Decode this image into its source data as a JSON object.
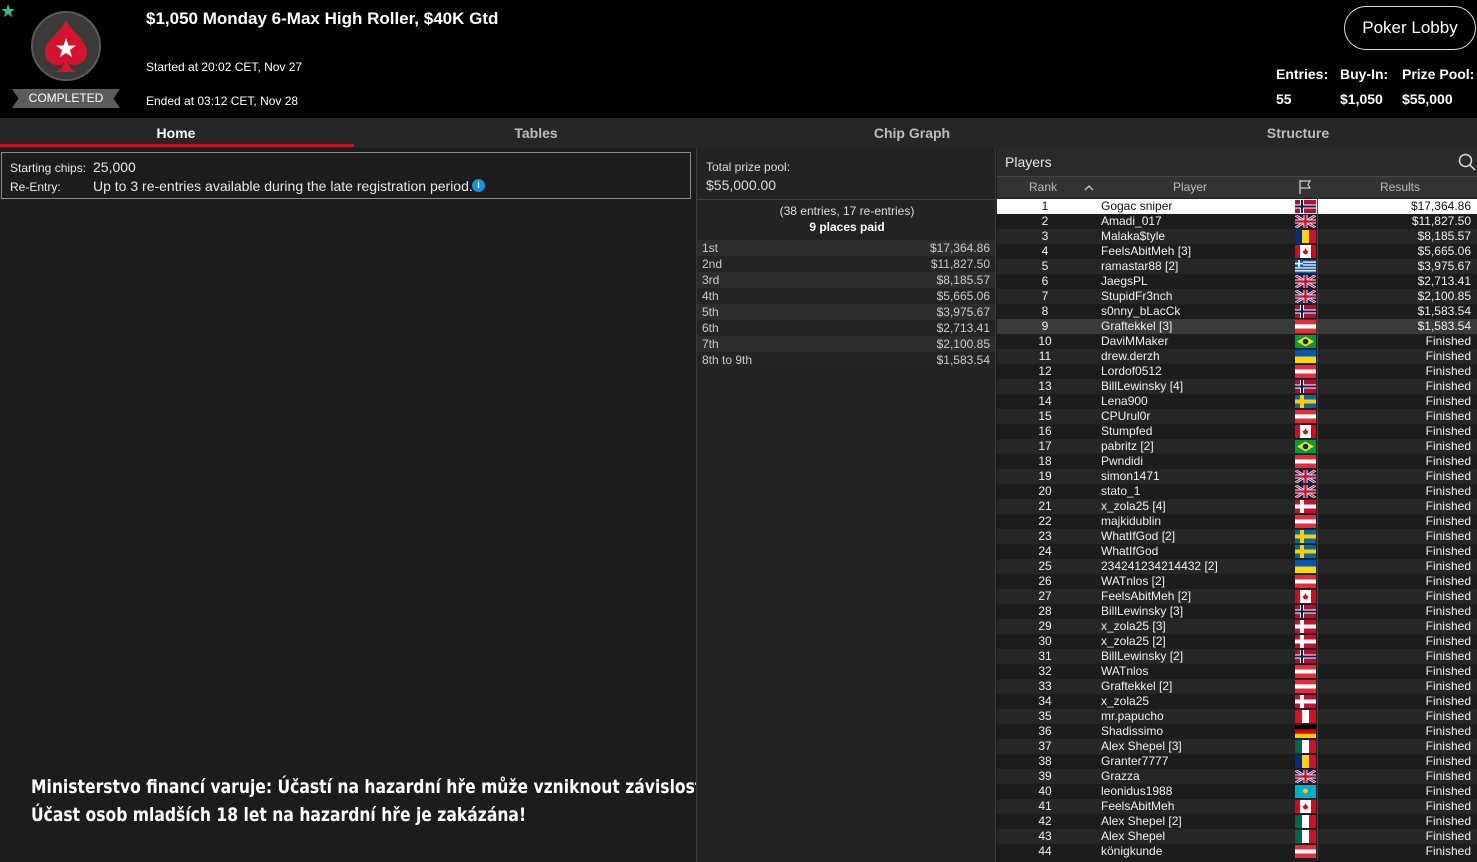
{
  "header": {
    "title": "$1,050 Monday 6-Max High Roller, $40K Gtd",
    "status_badge": "COMPLETED",
    "started": "Started at 20:02 CET, Nov 27",
    "ended": "Ended at 03:12 CET, Nov 28",
    "lobby_button": "Poker Lobby",
    "entries_label": "Entries:",
    "entries_value": "55",
    "buyin_label": "Buy-In:",
    "buyin_value": "$1,050",
    "prizepool_label": "Prize Pool:",
    "prizepool_value": "$55,000"
  },
  "tabs": [
    "Home",
    "Tables",
    "Chip Graph",
    "Structure"
  ],
  "info": {
    "starting_chips_label": "Starting chips:",
    "starting_chips_value": "25,000",
    "reentry_label": "Re-Entry:",
    "reentry_value": "Up to 3 re-entries available during the late registration period."
  },
  "warning": {
    "line1": "Ministerstvo financí varuje: Účastí na hazardní hře může vzniknout závislost!",
    "line2": "Účast osob mladších 18 let na hazardní hře je zakázána!"
  },
  "prize": {
    "pool_label": "Total prize pool:",
    "pool_value": "$55,000.00",
    "entries_text": "(38 entries, 17 re-entries)",
    "places_text": "9 places paid",
    "payouts": [
      {
        "place": "1st",
        "amount": "$17,364.86"
      },
      {
        "place": "2nd",
        "amount": "$11,827.50"
      },
      {
        "place": "3rd",
        "amount": "$8,185.57"
      },
      {
        "place": "4th",
        "amount": "$5,665.06"
      },
      {
        "place": "5th",
        "amount": "$3,975.67"
      },
      {
        "place": "6th",
        "amount": "$2,713.41"
      },
      {
        "place": "7th",
        "amount": "$2,100.85"
      },
      {
        "place": "8th to 9th",
        "amount": "$1,583.54"
      }
    ]
  },
  "players": {
    "title": "Players",
    "col_rank": "Rank",
    "col_player": "Player",
    "col_results": "Results",
    "rows": [
      {
        "rank": "1",
        "name": "Gogac sniper",
        "flag": "no",
        "result": "$17,364.86"
      },
      {
        "rank": "2",
        "name": "Amadi_017",
        "flag": "gb",
        "result": "$11,827.50"
      },
      {
        "rank": "3",
        "name": "Malaka$tyle",
        "flag": "ro",
        "result": "$8,185.57"
      },
      {
        "rank": "4",
        "name": "FeelsAbitMeh [3]",
        "flag": "ca",
        "result": "$5,665.06"
      },
      {
        "rank": "5",
        "name": "ramastar88 [2]",
        "flag": "gr",
        "result": "$3,975.67"
      },
      {
        "rank": "6",
        "name": "JaegsPL",
        "flag": "gb",
        "result": "$2,713.41"
      },
      {
        "rank": "7",
        "name": "StupidFr3nch",
        "flag": "gb",
        "result": "$2,100.85"
      },
      {
        "rank": "8",
        "name": "s0nny_bLacCk",
        "flag": "no",
        "result": "$1,583.54"
      },
      {
        "rank": "9",
        "name": "Graftekkel [3]",
        "flag": "at",
        "result": "$1,583.54"
      },
      {
        "rank": "10",
        "name": "DaviMMaker",
        "flag": "br",
        "result": "Finished"
      },
      {
        "rank": "11",
        "name": "drew.derzh",
        "flag": "ua",
        "result": "Finished"
      },
      {
        "rank": "12",
        "name": "Lordof0512",
        "flag": "at",
        "result": "Finished"
      },
      {
        "rank": "13",
        "name": "BillLewinsky [4]",
        "flag": "no",
        "result": "Finished"
      },
      {
        "rank": "14",
        "name": "Lena900",
        "flag": "se",
        "result": "Finished"
      },
      {
        "rank": "15",
        "name": "CPUrul0r",
        "flag": "at",
        "result": "Finished"
      },
      {
        "rank": "16",
        "name": "Stumpfed",
        "flag": "ca",
        "result": "Finished"
      },
      {
        "rank": "17",
        "name": "pabritz [2]",
        "flag": "br",
        "result": "Finished"
      },
      {
        "rank": "18",
        "name": "Pwndidi",
        "flag": "at",
        "result": "Finished"
      },
      {
        "rank": "19",
        "name": "simon1471",
        "flag": "gb",
        "result": "Finished"
      },
      {
        "rank": "20",
        "name": "stato_1",
        "flag": "gb",
        "result": "Finished"
      },
      {
        "rank": "21",
        "name": "x_zola25 [4]",
        "flag": "dk",
        "result": "Finished"
      },
      {
        "rank": "22",
        "name": "majkidublin",
        "flag": "at",
        "result": "Finished"
      },
      {
        "rank": "23",
        "name": "WhatIfGod [2]",
        "flag": "se",
        "result": "Finished"
      },
      {
        "rank": "24",
        "name": "WhatIfGod",
        "flag": "se",
        "result": "Finished"
      },
      {
        "rank": "25",
        "name": "234241234214432 [2]",
        "flag": "ua",
        "result": "Finished"
      },
      {
        "rank": "26",
        "name": "WATnlos [2]",
        "flag": "at",
        "result": "Finished"
      },
      {
        "rank": "27",
        "name": "FeelsAbitMeh [2]",
        "flag": "ca",
        "result": "Finished"
      },
      {
        "rank": "28",
        "name": "BillLewinsky [3]",
        "flag": "no",
        "result": "Finished"
      },
      {
        "rank": "29",
        "name": "x_zola25 [3]",
        "flag": "dk",
        "result": "Finished"
      },
      {
        "rank": "30",
        "name": "x_zola25 [2]",
        "flag": "dk",
        "result": "Finished"
      },
      {
        "rank": "31",
        "name": "BillLewinsky [2]",
        "flag": "no",
        "result": "Finished"
      },
      {
        "rank": "32",
        "name": "WATnlos",
        "flag": "at",
        "result": "Finished"
      },
      {
        "rank": "33",
        "name": "Graftekkel [2]",
        "flag": "at",
        "result": "Finished"
      },
      {
        "rank": "34",
        "name": "x_zola25",
        "flag": "dk",
        "result": "Finished"
      },
      {
        "rank": "35",
        "name": "mr.papucho",
        "flag": "pe",
        "result": "Finished"
      },
      {
        "rank": "36",
        "name": "Shadissimo",
        "flag": "de",
        "result": "Finished"
      },
      {
        "rank": "37",
        "name": "Alex Shepel [3]",
        "flag": "mx",
        "result": "Finished"
      },
      {
        "rank": "38",
        "name": "Granter7777",
        "flag": "ro",
        "result": "Finished"
      },
      {
        "rank": "39",
        "name": "Grazza",
        "flag": "gb",
        "result": "Finished"
      },
      {
        "rank": "40",
        "name": "leonidus1988",
        "flag": "kz",
        "result": "Finished"
      },
      {
        "rank": "41",
        "name": "FeelsAbitMeh",
        "flag": "ca",
        "result": "Finished"
      },
      {
        "rank": "42",
        "name": "Alex Shepel [2]",
        "flag": "mx",
        "result": "Finished"
      },
      {
        "rank": "43",
        "name": "Alex Shepel",
        "flag": "mx",
        "result": "Finished"
      },
      {
        "rank": "44",
        "name": "königkunde",
        "flag": "at",
        "result": "Finished"
      }
    ]
  },
  "colors": {
    "accent_red": "#c8102e",
    "completed_badge": "#5c5c5c",
    "info_icon": "#1a8fd8",
    "star": "#2fbf8f"
  }
}
